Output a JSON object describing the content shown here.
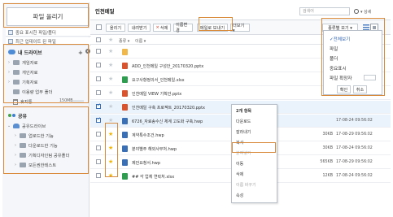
{
  "sidebar": {
    "upload_label": "파일 올리기",
    "quick": [
      "중요 표시한 파일/폴더",
      "최근 업데이트 된 파일"
    ],
    "drive_title": "내 드라이브",
    "drive_items": [
      {
        "label": "게임자료"
      },
      {
        "label": "개인자료"
      },
      {
        "label": "기획자료"
      },
      {
        "label": "이용량 업무 폴더"
      },
      {
        "label": "휴지통"
      }
    ],
    "usage_text": "150MB",
    "share_title": "공유",
    "share_drive": "공유드라이브",
    "share_items": [
      {
        "label": "업로드한 기능"
      },
      {
        "label": "다운로드한 기능"
      },
      {
        "label": "기획디자인팀 공유폴더"
      },
      {
        "label": "모든권한테스트"
      }
    ]
  },
  "main": {
    "title": "인천메일",
    "search_placeholder": "검색어",
    "detail_label": "▾ 상세",
    "toolbar": {
      "select_label": "올리기",
      "download_label": "내려받기",
      "delete_label": "삭제",
      "rename_label": "이름변경",
      "mail_label": "메일로 보내기",
      "more_label": "더보기 ▾",
      "sort_label": "종류별 보기 ▾"
    },
    "columns": {
      "type": "종류 ▾",
      "name": "이름 ▾"
    },
    "files": [
      {
        "name": "",
        "size": "",
        "date": "",
        "starred": false,
        "checked": false,
        "color": "#f0b84b"
      },
      {
        "name": "ADD_인천메일 구성안_20170320.pptx",
        "size": "",
        "date": "",
        "starred": false,
        "checked": false,
        "color": "#d9542e"
      },
      {
        "name": "요구사항정의서_인천메일.xlsx",
        "size": "",
        "date": "",
        "starred": false,
        "checked": false,
        "color": "#2e9d4f"
      },
      {
        "name": "인천메일 VIEW 기획안.pptx",
        "size": "",
        "date": "",
        "starred": false,
        "checked": false,
        "color": "#d9542e"
      },
      {
        "name": "인천메일 구축 프로젝트_20170320.pptx",
        "size": "",
        "date": "",
        "starred": false,
        "checked": true,
        "color": "#d9542e"
      },
      {
        "name": "6726_자료송수신 체계 고도화 구축.hwp",
        "size": "",
        "date": "17-08-24 09:56:02",
        "starred": false,
        "checked": true,
        "color": "#3b6fb5"
      },
      {
        "name": "계약특수조건.hwp",
        "size": "30KB",
        "date": "17-08-29 09:56:02",
        "starred": true,
        "checked": false,
        "color": "#3b6fb5"
      },
      {
        "name": "분야별주 해외사무처.hwp",
        "size": "30KB",
        "date": "17-08-24 09:56:02",
        "starred": true,
        "checked": false,
        "color": "#3b6fb5"
      },
      {
        "name": "제안요청서.hwp",
        "size": "565KB",
        "date": "17-08-29 09:56:02",
        "starred": true,
        "checked": false,
        "color": "#3b6fb5"
      },
      {
        "name": "## 각 업체 연락처.xlsx",
        "size": "12KB",
        "date": "17-08-24 09:56:02",
        "starred": true,
        "checked": false,
        "color": "#2e9d4f"
      }
    ]
  },
  "context_menu": {
    "items": [
      {
        "label": "2개 항목",
        "kind": "head"
      },
      {
        "label": "다운로드",
        "kind": ""
      },
      {
        "label": "잘라내기",
        "kind": ""
      },
      {
        "label": "복사",
        "kind": ""
      },
      {
        "label": "붙여넣기",
        "kind": "dim"
      },
      {
        "label": "이동",
        "kind": "hl"
      },
      {
        "label": "삭제",
        "kind": ""
      },
      {
        "label": "이름 바꾸기",
        "kind": "dim"
      },
      {
        "label": "속성",
        "kind": ""
      }
    ]
  },
  "sort_dropdown": {
    "items": [
      {
        "label": "✓전체보기",
        "selected": true
      },
      {
        "label": "파일",
        "selected": false
      },
      {
        "label": "폴더",
        "selected": false
      },
      {
        "label": "중요표시",
        "selected": false
      },
      {
        "label": "파일 확장자",
        "selected": false
      }
    ],
    "confirm_label": "확인",
    "cancel_label": "취소"
  },
  "colors": {
    "accent": "#d98a3a",
    "link": "#2a5fb0",
    "star": "#f4b400"
  }
}
